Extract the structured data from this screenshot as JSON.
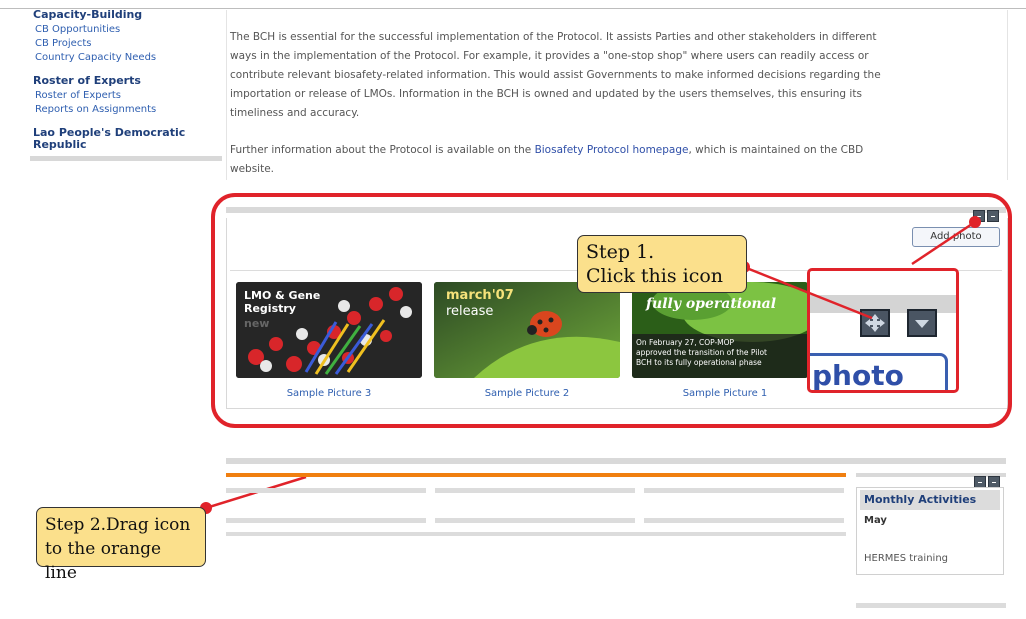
{
  "sidebar": {
    "sections": [
      {
        "title": "Capacity-Building",
        "links": [
          "CB Opportunities",
          "CB Projects",
          "Country Capacity Needs"
        ]
      },
      {
        "title": "Roster of Experts",
        "links": [
          "Roster of Experts",
          "Reports on Assignments"
        ]
      },
      {
        "title_lines": [
          "Lao People's Democratic",
          "Republic"
        ]
      }
    ]
  },
  "content": {
    "para1_lines": [
      "The BCH is essential for the successful implementation of the Protocol. It assists Parties and other stakeholders in different",
      "ways in the implementation of the Protocol. For example, it provides a \"one-stop shop\" where users can readily access or",
      "contribute relevant biosafety-related information. This would assist Governments to make informed decisions regarding the",
      "importation or release of LMOs. Information in the BCH is owned and updated by the users themselves, this ensuring its",
      "timeliness and accuracy."
    ],
    "para2_before": "Further information about the Protocol is available on the ",
    "para2_link": "Biosafety Protocol homepage",
    "para2_after": ", which is maintained on the CBD",
    "para2_line2": "website."
  },
  "photo_widget": {
    "add_photo_label": "Add photo",
    "pictures": [
      {
        "caption": "Sample Picture 3",
        "lines": [
          "LMO & Gene",
          "Registry",
          "new"
        ]
      },
      {
        "caption": "Sample Picture 2",
        "lines": [
          "march'07",
          "release"
        ]
      },
      {
        "caption": "Sample Picture 1",
        "lines": [
          "fully operational",
          "On February 27, COP-MOP",
          "approved the transition of the Pilot",
          "BCH to its fully operational phase"
        ]
      }
    ],
    "zoom_text": "photo"
  },
  "annotations": {
    "step1_lines": [
      "Step 1.",
      "Click this icon"
    ],
    "step2_lines": [
      "Step 2.Drag icon",
      "to the orange line"
    ],
    "color": "#e0232a",
    "callout_bg": "#fbe08c"
  },
  "monthly": {
    "title": "Monthly Activities",
    "month": "May",
    "item": "HERMES training"
  },
  "colors": {
    "link": "#2f5fb0",
    "heading": "#1f3f7a",
    "orange_line": "#f07f10"
  }
}
